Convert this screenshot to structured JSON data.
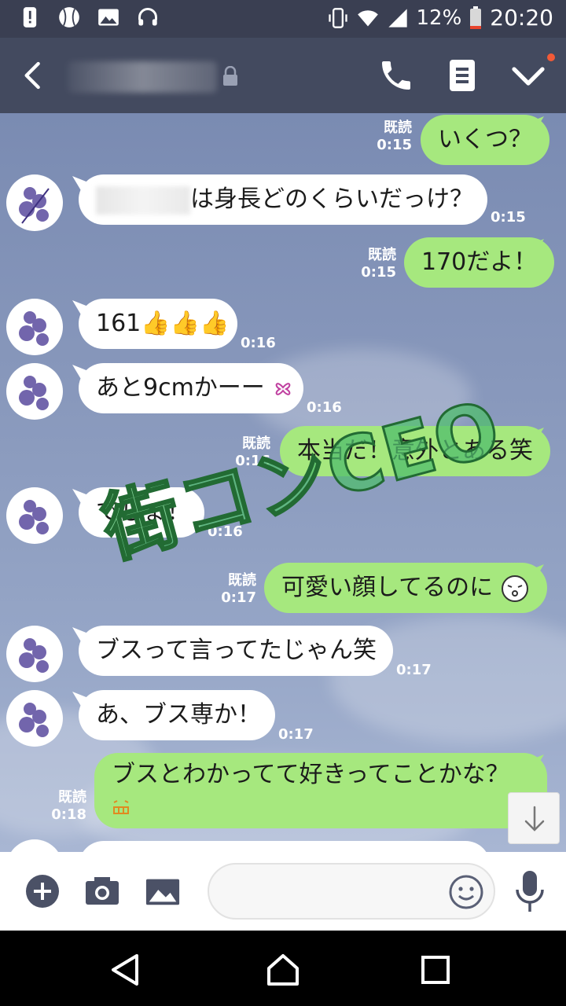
{
  "status_bar": {
    "battery_percent": "12%",
    "time": "20:20",
    "icons": [
      "alert-icon",
      "baseball-icon",
      "image-icon",
      "headset-icon",
      "vibrate-icon",
      "wifi-icon",
      "signal-icon",
      "battery-icon"
    ]
  },
  "header": {
    "icons": [
      "back-icon",
      "lock-icon",
      "phone-icon",
      "note-icon",
      "chevron-down-icon"
    ],
    "notification_dot_color": "#f25a37"
  },
  "chat": {
    "read_label": "既読",
    "watermark": "街コンCEO",
    "messages": [
      {
        "side": "out",
        "text": "いくつ？",
        "time": "0:15",
        "read": true
      },
      {
        "side": "in",
        "text": "は身長どのくらいだっけ？",
        "time": "0:15"
      },
      {
        "side": "out",
        "text": "170だよ！",
        "time": "0:15",
        "read": true
      },
      {
        "side": "in",
        "text": "161",
        "emoji": "👍👍👍",
        "time": "0:16"
      },
      {
        "side": "in",
        "text": "あと9cmかーー",
        "time": "0:16"
      },
      {
        "side": "out",
        "text": "本当だ！意外とある笑",
        "time": "0:16",
        "read": true
      },
      {
        "side": "in",
        "text": "でしょ！",
        "time": "0:16"
      },
      {
        "side": "out",
        "text": "可愛い顔してるのに",
        "time": "0:17",
        "read": true
      },
      {
        "side": "in",
        "text": "ブスって言ってたじゃん笑",
        "time": "0:17"
      },
      {
        "side": "in",
        "text": "あ、ブス専か！",
        "time": "0:17"
      },
      {
        "side": "out",
        "text": "ブスとわかってて好きってことかな？",
        "time": "0:18",
        "read": true
      }
    ]
  },
  "input_bar": {
    "icons": [
      "plus-icon",
      "camera-icon",
      "gallery-icon",
      "emoji-icon",
      "mic-icon"
    ],
    "placeholder": ""
  },
  "nav_bar": {
    "icons": [
      "back-triangle-icon",
      "home-icon",
      "recents-icon"
    ]
  },
  "colors": {
    "header": "#434a5f",
    "outgoing_bubble": "#a6e87e",
    "incoming_bubble": "#ffffff"
  }
}
